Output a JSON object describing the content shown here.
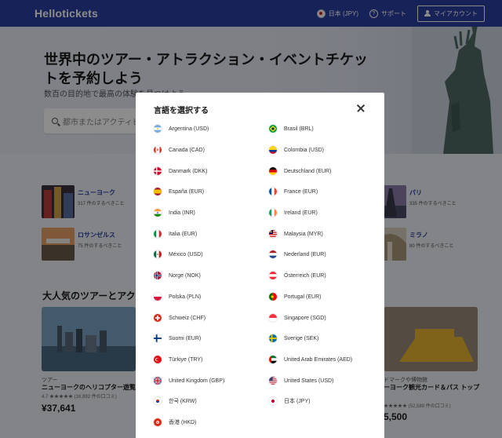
{
  "header": {
    "logo": "Hellotickets",
    "language": "日本 (JPY)",
    "support": "サポート",
    "account": "マイアカウント"
  },
  "hero": {
    "title": "世界中のツアー・アトラクション・イベントチケットを予約しよう",
    "subtitle": "数百の目的地で最高の体験を見つけよう",
    "search_placeholder": "都市またはアクティビ"
  },
  "cities": [
    {
      "name": "ニューヨーク",
      "count": "317 件のするべきこと"
    },
    {
      "name": "ロサンゼルス",
      "count": "75 件のするべきこと"
    },
    {
      "name": "パリ",
      "count": "335 件のするべきこと"
    },
    {
      "name": "ミラノ",
      "count": "80 件のするべきこと"
    }
  ],
  "section_title": "大人気のツアーとアクテ",
  "tours": [
    {
      "tag": "ツアー",
      "name": "ニューヨークのヘリコプター遊覧飛",
      "rating": "4.7 ★★★★★ (16,992 件の口コミ)",
      "price": "¥37,641"
    },
    {
      "tag": "ドマークや博物館",
      "name": "ーヨーク観光カード＆パス トップ",
      "rating": "★★★★★ (52,589 件の口コミ)",
      "price": "5,500"
    }
  ],
  "modal": {
    "title": "言語を選択する",
    "languages": [
      {
        "label": "Argentina (USD)",
        "flag": "argentina-flag-icon"
      },
      {
        "label": "Brasil (BRL)",
        "flag": "brazil-flag-icon"
      },
      {
        "label": "Canada (CAD)",
        "flag": "canada-flag-icon"
      },
      {
        "label": "Colombia (USD)",
        "flag": "colombia-flag-icon"
      },
      {
        "label": "Danmark (DKK)",
        "flag": "denmark-flag-icon"
      },
      {
        "label": "Deutschland (EUR)",
        "flag": "germany-flag-icon"
      },
      {
        "label": "España (EUR)",
        "flag": "spain-flag-icon"
      },
      {
        "label": "France (EUR)",
        "flag": "france-flag-icon"
      },
      {
        "label": "India (INR)",
        "flag": "india-flag-icon"
      },
      {
        "label": "Ireland (EUR)",
        "flag": "ireland-flag-icon"
      },
      {
        "label": "Italia (EUR)",
        "flag": "italy-flag-icon"
      },
      {
        "label": "Malaysia (MYR)",
        "flag": "malaysia-flag-icon"
      },
      {
        "label": "México (USD)",
        "flag": "mexico-flag-icon"
      },
      {
        "label": "Nederland (EUR)",
        "flag": "netherlands-flag-icon"
      },
      {
        "label": "Norge (NOK)",
        "flag": "norway-flag-icon"
      },
      {
        "label": "Österreich (EUR)",
        "flag": "austria-flag-icon"
      },
      {
        "label": "Polska (PLN)",
        "flag": "poland-flag-icon"
      },
      {
        "label": "Portugal (EUR)",
        "flag": "portugal-flag-icon"
      },
      {
        "label": "Schweiz (CHF)",
        "flag": "switzerland-flag-icon"
      },
      {
        "label": "Singapore (SGD)",
        "flag": "singapore-flag-icon"
      },
      {
        "label": "Suomi (EUR)",
        "flag": "finland-flag-icon"
      },
      {
        "label": "Sverige (SEK)",
        "flag": "sweden-flag-icon"
      },
      {
        "label": "Türkiye (TRY)",
        "flag": "turkey-flag-icon"
      },
      {
        "label": "United Arab Emirates (AED)",
        "flag": "uae-flag-icon"
      },
      {
        "label": "United Kingdom (GBP)",
        "flag": "uk-flag-icon"
      },
      {
        "label": "United States (USD)",
        "flag": "usa-flag-icon"
      },
      {
        "label": "한국 (KRW)",
        "flag": "korea-flag-icon"
      },
      {
        "label": "日本 (JPY)",
        "flag": "japan-flag-icon"
      },
      {
        "label": "香港 (HKD)",
        "flag": "hongkong-flag-icon"
      }
    ]
  }
}
